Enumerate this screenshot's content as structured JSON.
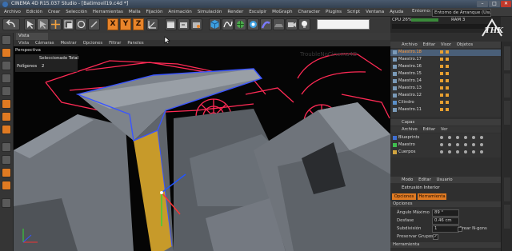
{
  "titlebar": {
    "title": "CINEMA 4D R15.037 Studio - [Batimovil19.c4d *]",
    "min": "–",
    "max": "□",
    "close": "✕",
    "close_color": "#c0392b"
  },
  "menubar": {
    "items": [
      "Archivo",
      "Edición",
      "Crear",
      "Selección",
      "Herramientas",
      "Malla",
      "Fijación",
      "Animación",
      "Simulación",
      "Render",
      "Esculpir",
      "MoGraph",
      "Character",
      "Plugins",
      "Script",
      "Ventana",
      "Ayuda"
    ],
    "layout_label": "Entorno:",
    "layout_value": "Entorno de Arranque (Usuario)"
  },
  "toolbar": {
    "axis_labels": [
      "X",
      "Y",
      "Z"
    ],
    "accent_color": "#e8842a"
  },
  "viewport": {
    "tab_label": "Vista",
    "menu_items": [
      "Vista",
      "Cámaras",
      "Mostrar",
      "Opciones",
      "Filtrar",
      "Paneles"
    ],
    "view_name": "Perspectiva",
    "stats_label_1": "Seleccionado Total",
    "stats_label_2": "Polígonos",
    "stats_value_2": "2",
    "wire_color": "#ff2a55",
    "selection_color": "#3a55ff",
    "selected_face_color": "#c79a2a"
  },
  "stats_panel": {
    "cpu_label": "CPU 26%",
    "ram_label": "RAM 3"
  },
  "object_manager": {
    "menu_items": [
      "Archivo",
      "Editar",
      "Visor",
      "Objetos"
    ],
    "objects": [
      "Maestro.18",
      "Maestro.17",
      "Maestro.16",
      "Maestro.15",
      "Maestro.14",
      "Maestro.13",
      "Maestro.12",
      "Cilindro",
      "Maestro.11"
    ]
  },
  "layer_manager": {
    "title": "Capas",
    "menu_items": [
      "Archivo",
      "Editar",
      "Ver"
    ],
    "layers": [
      {
        "name": "Blueprints",
        "color": "#3f6fd1"
      },
      {
        "name": "Maestro",
        "color": "#3fbf4f"
      },
      {
        "name": "Cuerpos",
        "color": "#d1a43f"
      }
    ]
  },
  "attribute_manager": {
    "menu_items": [
      "Modo",
      "Editar",
      "Usuario"
    ],
    "tool_name": "Extrusión Interior",
    "tabs": [
      "Opciones",
      "Herramienta"
    ],
    "section": "Opciones",
    "fields": {
      "angle_label": "Ángulo Máximo",
      "angle_value": "89 °",
      "offset_label": "Desfase",
      "offset_value": "0.46 cm",
      "subdiv_label": "Subdivisión",
      "subdiv_value": "1",
      "create_ngons_label": "Crear N-gons",
      "preserve_groups_label": "Preservar Grupos",
      "tool_section_label": "Herramienta"
    }
  },
  "watermark": {
    "text": "THK",
    "small_text": "TroubleNoCinema4D"
  }
}
